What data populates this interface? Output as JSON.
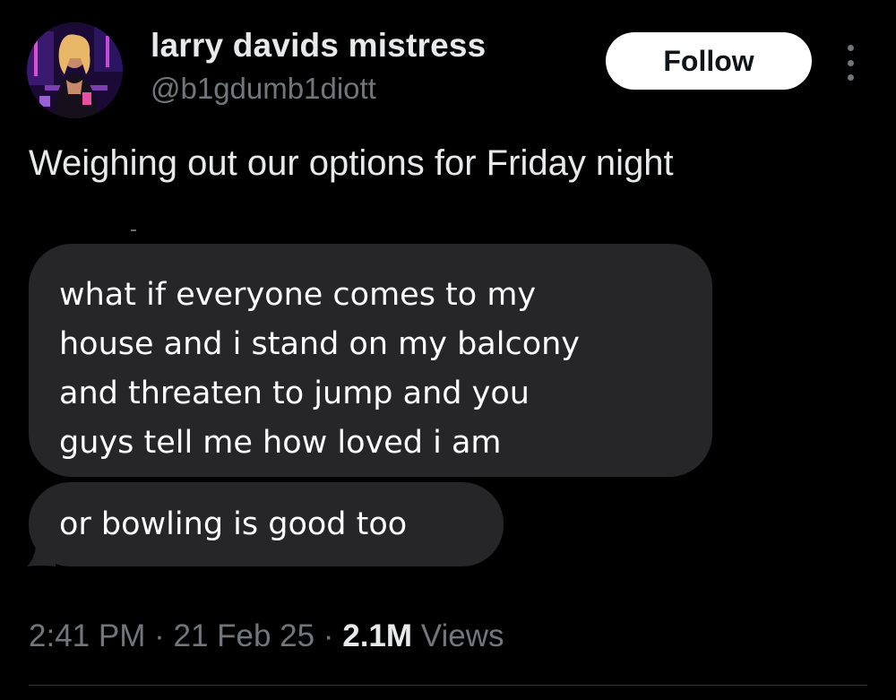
{
  "author": {
    "display_name": "larry davids mistress",
    "handle": "@b1gdumb1diott",
    "avatar_icon": "profile-photo"
  },
  "actions": {
    "follow_label": "Follow",
    "more_icon": "more-vertical-icon"
  },
  "tweet": {
    "text": "Weighing out our options for Friday night"
  },
  "media": {
    "messages": [
      {
        "lines": [
          "what if everyone comes to my",
          "house and i stand on my balcony",
          "and threaten to jump and you",
          "guys tell me how loved i am"
        ]
      },
      {
        "lines": [
          "or bowling is good too"
        ]
      }
    ],
    "bubble_color": "#262628"
  },
  "meta": {
    "time": "2:41 PM",
    "separator": "·",
    "date": "21 Feb 25",
    "views_count": "2.1M",
    "views_label": "Views"
  },
  "colors": {
    "background": "#000000",
    "primary_text": "#e7e9ea",
    "secondary_text": "#71767b",
    "follow_bg": "#ffffff"
  }
}
